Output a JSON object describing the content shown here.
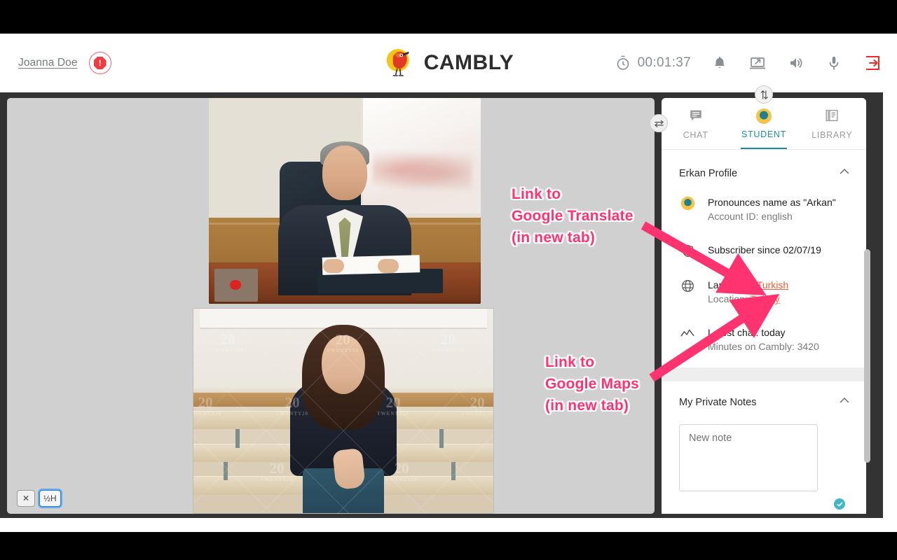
{
  "header": {
    "teacher_name": "Joanna Doe",
    "alert_icon": "alert-octagon-icon",
    "logo_text": "CAMBLY",
    "timer": "00:01:37",
    "icons": {
      "timer": "stopwatch-icon",
      "bell": "bell-icon",
      "screen_share": "screen-share-icon",
      "volume": "volume-icon",
      "microphone": "microphone-icon",
      "exit": "exit-icon"
    }
  },
  "video": {
    "controls": {
      "shuffle_label": "✕",
      "half_height_label": "½H"
    },
    "swap_handle": "swap-horizontal-icon",
    "vresize_handle": "resize-vertical-icon",
    "watermark_num": "20",
    "watermark_label": "TWENTY20"
  },
  "panel": {
    "tabs": [
      {
        "label": "CHAT",
        "icon": "chat-icon",
        "active": false
      },
      {
        "label": "STUDENT",
        "icon": "student-avatar-icon",
        "active": true
      },
      {
        "label": "LIBRARY",
        "icon": "library-icon",
        "active": false
      }
    ],
    "profile": {
      "title": "Erkan Profile",
      "rows": [
        {
          "icon": "student-avatar-icon",
          "main": "Pronounces name as \"Arkan\"",
          "sub": "Account ID: english"
        },
        {
          "icon": "shield-check-icon",
          "main": "Subscriber since 02/07/19",
          "sub": ""
        },
        {
          "icon": "globe-icon",
          "main_prefix": "Language: ",
          "main_link": "Turkish",
          "sub_prefix": "Location: ",
          "sub_link": "Turkey"
        },
        {
          "icon": "activity-line-icon",
          "main": "Latest chat: today",
          "sub": "Minutes on Cambly: 3420"
        }
      ]
    },
    "notes": {
      "title": "My Private Notes",
      "placeholder": "New note",
      "saved_icon": "check-circle-icon"
    }
  },
  "annotations": [
    {
      "line1": "Link to",
      "line2": "Google Translate",
      "line3": "(in new tab)"
    },
    {
      "line1": "Link to",
      "line2": "Google Maps",
      "line3": "(in new tab)"
    }
  ],
  "colors": {
    "accent_teal": "#1a8f9e",
    "link_orange": "#e8603a",
    "alert_red": "#ef3b41",
    "annotation_pink": "#ff3370",
    "logo_yellow": "#f5c518"
  }
}
